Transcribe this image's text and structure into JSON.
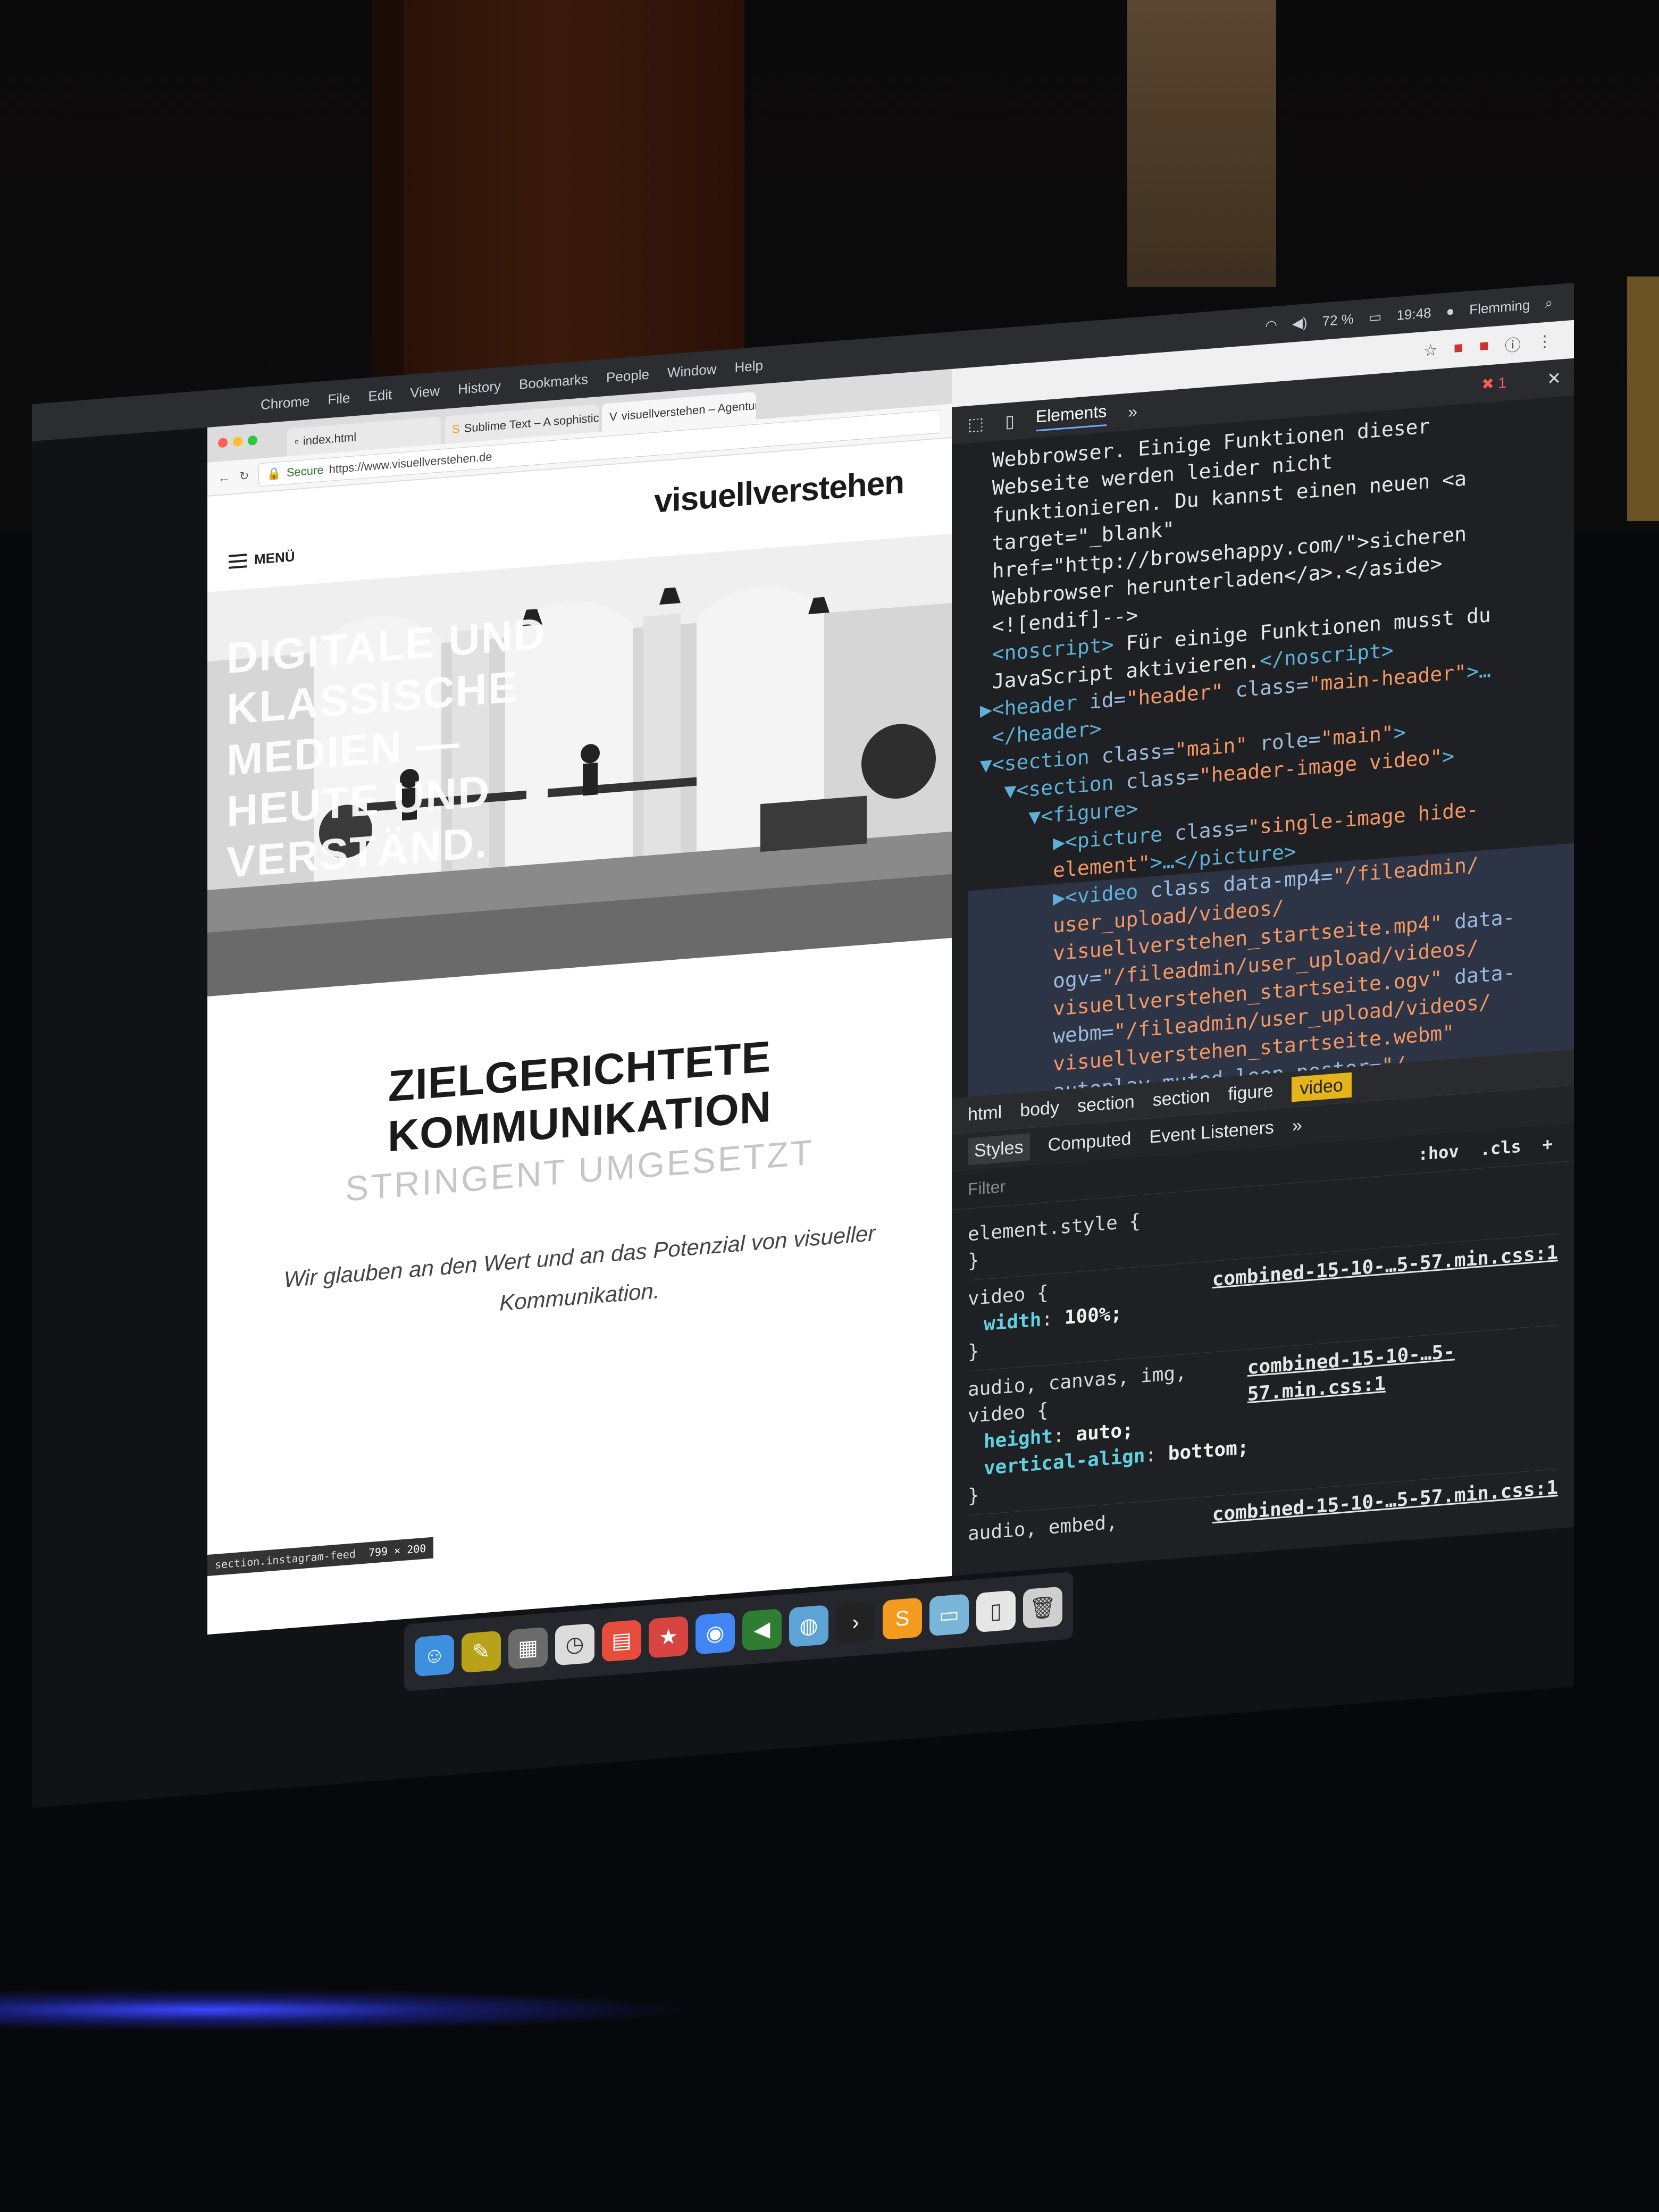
{
  "menubar": {
    "apple": "",
    "items": [
      "Chrome",
      "File",
      "Edit",
      "View",
      "History",
      "Bookmarks",
      "People",
      "Window",
      "Help"
    ],
    "battery": "72 %",
    "clock": "19:48",
    "user": "Flemming"
  },
  "browser": {
    "tabs": [
      {
        "label": "index.html"
      },
      {
        "label": "Sublime Text – A sophisticate"
      },
      {
        "label": "visuellverstehen – Agentur f"
      }
    ],
    "address": {
      "secure_label": "Secure",
      "url": "https://www.visuellverstehen.de"
    }
  },
  "site": {
    "logo": "visuellverstehen",
    "menu_label": "MENÜ",
    "hero_lines": [
      "DIGITALE UND",
      "KLASSISCHE",
      "MEDIEN —",
      "HEUTE UND",
      "VERSTÄND."
    ],
    "headline": "ZIELGERICHTETE KOMMUNIKATION",
    "subheadline": "STRINGENT UMGESETZT",
    "lead": "Wir glauben an den Wert und an das Potenzial von visueller Kommunikation.",
    "inspect_tip": {
      "selector": "section.instagram-feed",
      "dims": "799 × 200"
    }
  },
  "devtools": {
    "tab_elements": "Elements",
    "tab_more": "»",
    "error_count": "1",
    "breadcrumbs": [
      "html",
      "body",
      "section",
      "section",
      "figure",
      "video"
    ],
    "styles_tabs": [
      "Styles",
      "Computed",
      "Event Listeners",
      "»"
    ],
    "filter_placeholder": "Filter",
    "filter_hov": ":hov",
    "filter_cls": ".cls",
    "filter_add": "+",
    "rules": [
      {
        "selector": "element.style {",
        "source": "",
        "props": [],
        "close": "}"
      },
      {
        "selector": "video {",
        "source": "combined-15-10-…5-57.min.css:1",
        "props": [
          {
            "name": "width",
            "value": "100%;"
          }
        ],
        "close": "}"
      },
      {
        "selector": "audio, canvas, img, video {",
        "source": "combined-15-10-…5-57.min.css:1",
        "props": [
          {
            "name": "height",
            "value": "auto;"
          },
          {
            "name": "vertical-align",
            "value": "bottom;"
          }
        ],
        "close": "}"
      },
      {
        "selector": "audio, embed,",
        "source": "combined-15-10-…5-57.min.css:1",
        "props": [],
        "close": ""
      }
    ]
  },
  "colors": {
    "accent_crumb": "#e3b51a",
    "tag": "#5db0d7",
    "value": "#f29766"
  }
}
